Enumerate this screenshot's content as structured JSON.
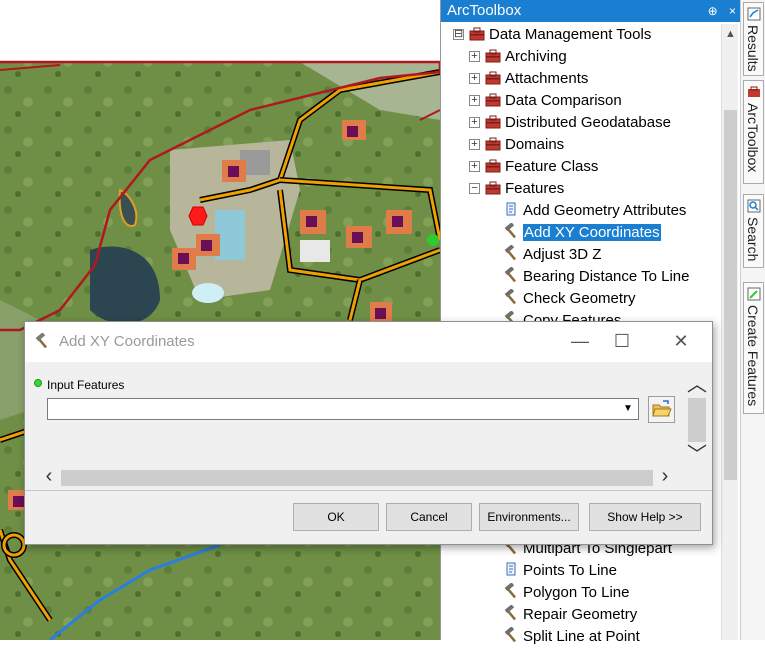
{
  "toolbox": {
    "title": "ArcToolbox",
    "pin": "⊕",
    "close": "×",
    "tree": [
      {
        "label": "Data Management Tools",
        "type": "toolbox",
        "expander": "⊟"
      },
      {
        "label": "Archiving",
        "type": "toolset",
        "expander": "+"
      },
      {
        "label": "Attachments",
        "type": "toolset",
        "expander": "+"
      },
      {
        "label": "Data Comparison",
        "type": "toolset",
        "expander": "+"
      },
      {
        "label": "Distributed Geodatabase",
        "type": "toolset",
        "expander": "+"
      },
      {
        "label": "Domains",
        "type": "toolset",
        "expander": "+"
      },
      {
        "label": "Feature Class",
        "type": "toolset",
        "expander": "+"
      },
      {
        "label": "Features",
        "type": "toolset",
        "expander": "−"
      },
      {
        "label": "Add Geometry Attributes",
        "type": "script"
      },
      {
        "label": "Add XY Coordinates",
        "type": "tool",
        "selected": true
      },
      {
        "label": "Adjust 3D Z",
        "type": "tool"
      },
      {
        "label": "Bearing Distance To Line",
        "type": "tool"
      },
      {
        "label": "Check Geometry",
        "type": "tool"
      },
      {
        "label": "Copy Features",
        "type": "tool"
      },
      {
        "label": "Multipart To Singlepart",
        "type": "tool"
      },
      {
        "label": "Points To Line",
        "type": "script"
      },
      {
        "label": "Polygon To Line",
        "type": "tool"
      },
      {
        "label": "Repair Geometry",
        "type": "tool"
      },
      {
        "label": "Split Line at Point",
        "type": "tool"
      }
    ]
  },
  "side_tabs": [
    "Results",
    "ArcToolbox",
    "Search",
    "Create Features"
  ],
  "dialog": {
    "title": "Add XY Coordinates",
    "minimize": "—",
    "maximize": "☐",
    "close": "✕",
    "param_label": "Input Features",
    "input_value": "",
    "buttons": {
      "ok": "OK",
      "cancel": "Cancel",
      "environments": "Environments...",
      "show_help": "Show Help >>"
    }
  },
  "colors": {
    "selection": "#1a7fd1",
    "titlebar": "#1a7fd1",
    "required_dot": "#3bd43b"
  }
}
